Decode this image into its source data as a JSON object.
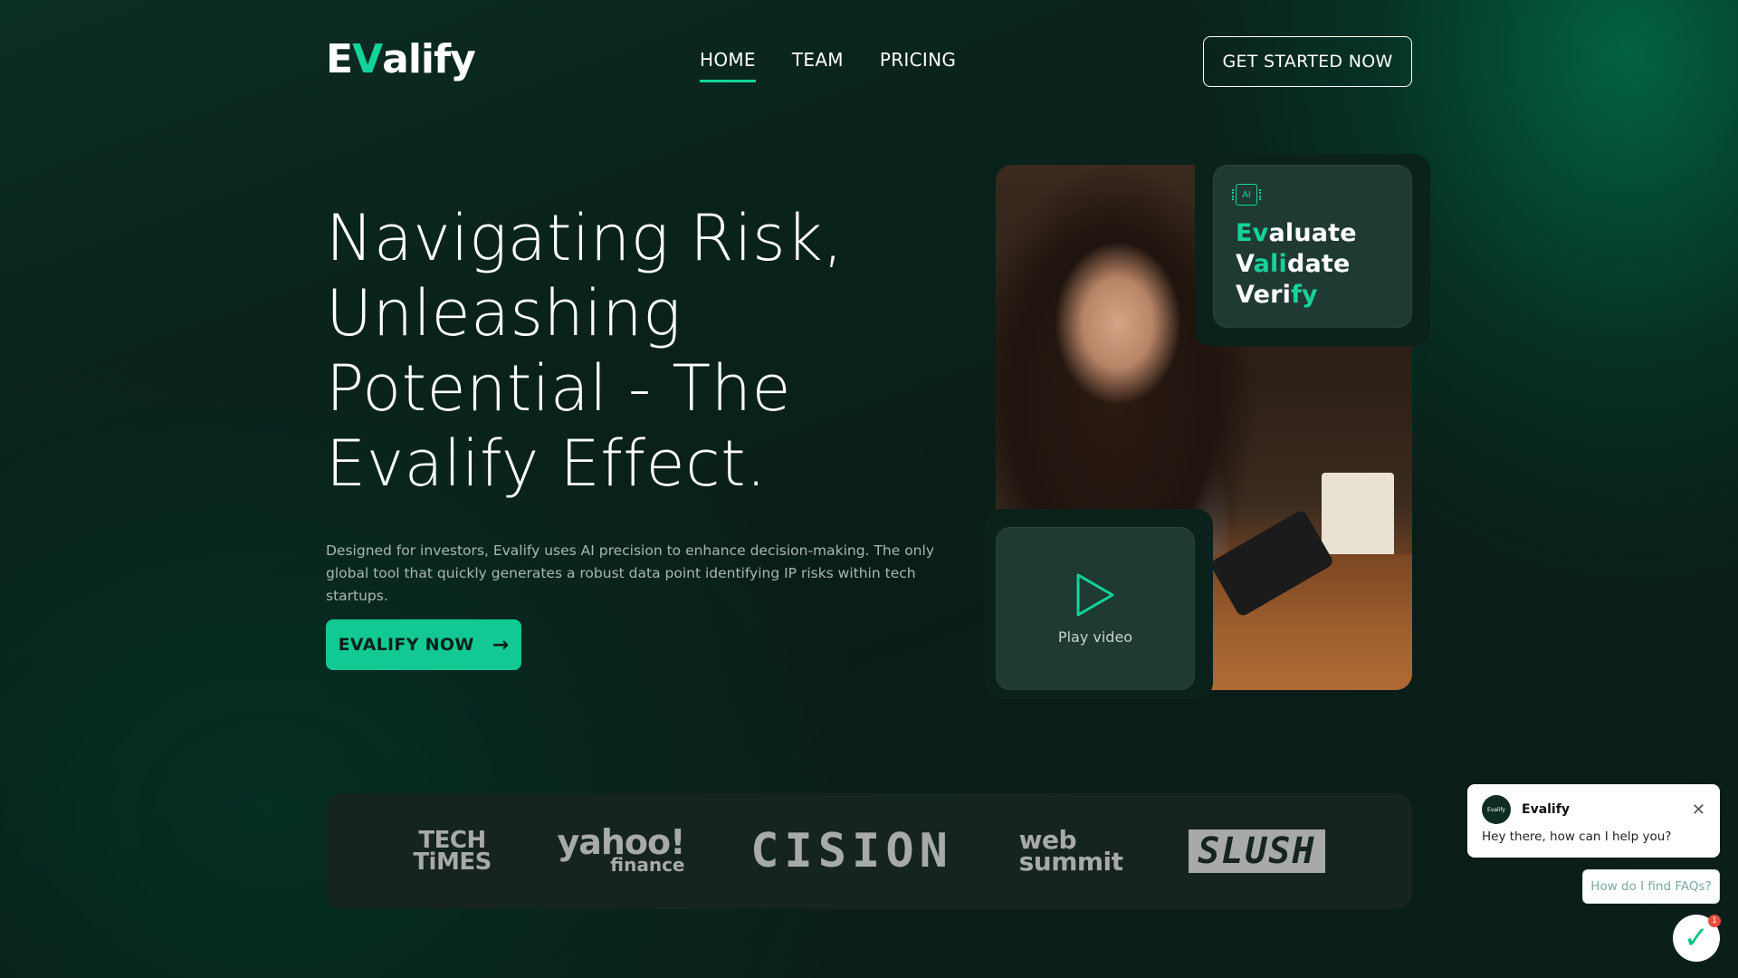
{
  "brand": {
    "logo_prefix": "E",
    "logo_accent": "V",
    "logo_suffix": "alify",
    "accent_color": "#14d39a"
  },
  "nav": {
    "items": [
      {
        "label": "HOME",
        "active": true
      },
      {
        "label": "TEAM",
        "active": false
      },
      {
        "label": "PRICING",
        "active": false
      }
    ],
    "cta_label": "GET STARTED NOW"
  },
  "hero": {
    "title_lines": [
      "Navigating Risk,",
      "Unleashing",
      "Potential - The",
      "Evalify Effect."
    ],
    "description": "Designed for investors, Evalify uses AI precision to enhance decision-making. The only global tool that quickly generates a robust data point identifying IP risks within tech startups.",
    "cta_label": "EVALIFY NOW",
    "cta_icon": "arrow-right-icon"
  },
  "feature_card": {
    "icon_label": "AI",
    "lines": [
      {
        "accent": "Ev",
        "rest": "aluate"
      },
      {
        "pre": "V",
        "accent": "ali",
        "rest": "date"
      },
      {
        "pre": "Veri",
        "accent": "fy",
        "rest": ""
      }
    ]
  },
  "video_card": {
    "label": "Play video",
    "icon": "play-icon"
  },
  "press": {
    "logos": [
      {
        "line1": "TECH",
        "line2": "TiMES"
      },
      {
        "main": "yahoo!",
        "sub": "finance"
      },
      {
        "main": "CISION"
      },
      {
        "line1": "web",
        "line2": "summit"
      },
      {
        "main": "SLUSH"
      }
    ]
  },
  "chat": {
    "avatar_text": "Evalify",
    "name": "Evalify",
    "message": "Hey there, how can I help you?",
    "quick_reply": "How do I find FAQs?",
    "launcher_glyph": "✓",
    "badge_count": "1"
  }
}
